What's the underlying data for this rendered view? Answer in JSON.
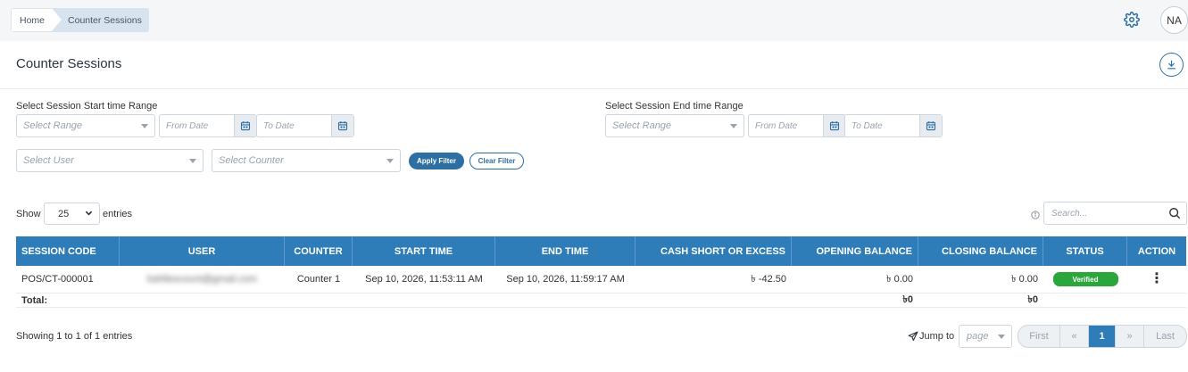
{
  "breadcrumb": {
    "home": "Home",
    "current": "Counter Sessions"
  },
  "user": {
    "initials": "NA"
  },
  "page": {
    "title": "Counter Sessions"
  },
  "filters": {
    "start_label": "Select Session Start time Range",
    "end_label": "Select Session End time Range",
    "range_placeholder": "Select Range",
    "from_placeholder": "From Date",
    "to_placeholder": "To Date",
    "user_placeholder": "Select User",
    "counter_placeholder": "Select Counter",
    "apply_label": "Apply Filter",
    "clear_label": "Clear Filter"
  },
  "entries": {
    "show_label": "Show",
    "value": "25",
    "suffix": "entries"
  },
  "search": {
    "placeholder": "Search..."
  },
  "table": {
    "headers": [
      "SESSION CODE",
      "USER",
      "COUNTER",
      "START TIME",
      "END TIME",
      "CASH SHORT OR EXCESS",
      "OPENING BALANCE",
      "CLOSING BALANCE",
      "STATUS",
      "ACTION"
    ],
    "rows": [
      {
        "session_code": "POS/CT-000001",
        "user": "bahllescount@gmail.com",
        "counter": "Counter 1",
        "start_time": "Sep 10, 2026, 11:53:11 AM",
        "end_time": "Sep 10, 2026, 11:59:17 AM",
        "cash_short_excess": "৳ -42.50",
        "opening_balance": "৳ 0.00",
        "closing_balance": "৳ 0.00",
        "status": "Verified"
      }
    ],
    "total": {
      "label": "Total:",
      "opening": "৳0",
      "closing": "৳0"
    }
  },
  "footer": {
    "showing": "Showing 1 to 1 of 1 entries",
    "jump_label": "Jump to",
    "page_placeholder": "page",
    "pager": {
      "first": "First",
      "prev": "«",
      "current": "1",
      "next": "»",
      "last": "Last"
    }
  },
  "colors": {
    "primary": "#2e7db8",
    "accent": "#2e6fa3",
    "success": "#2aa63a"
  }
}
